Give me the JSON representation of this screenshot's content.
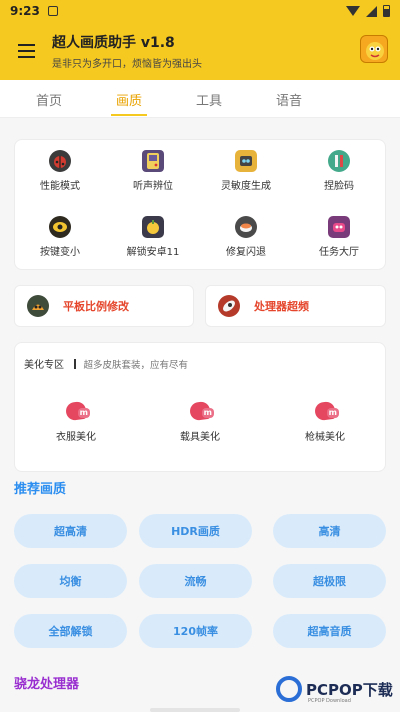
{
  "status": {
    "time": "9:23"
  },
  "app": {
    "title": "超人画质助手 v1.8",
    "subtitle": "是非只为多开口，烦恼皆为强出头"
  },
  "tabs": [
    {
      "label": "首页"
    },
    {
      "label": "画质"
    },
    {
      "label": "工具"
    },
    {
      "label": "语音"
    }
  ],
  "grid": [
    {
      "label": "性能模式",
      "icon": "ladybug-icon",
      "color": "#3b3b3b"
    },
    {
      "label": "听声辨位",
      "icon": "gameboy-icon",
      "color": "#5a4a7a"
    },
    {
      "label": "灵敏度生成",
      "icon": "robot-icon",
      "color": "#e8b33a"
    },
    {
      "label": "捏脸码",
      "icon": "ruler-icon",
      "color": "#43a98a"
    },
    {
      "label": "按键变小",
      "icon": "eye-icon",
      "color": "#2e2a20"
    },
    {
      "label": "解锁安卓11",
      "icon": "lemon-icon",
      "color": "#3a3a4a"
    },
    {
      "label": "修复闪退",
      "icon": "sushi-icon",
      "color": "#4a4a4a"
    },
    {
      "label": "任务大厅",
      "icon": "monster-icon",
      "color": "#7a3b7a"
    }
  ],
  "wide": [
    {
      "label": "平板比例修改",
      "icon": "slime-icon",
      "color": "#3e4a3a"
    },
    {
      "label": "处理器超频",
      "icon": "rocket-icon",
      "color": "#b53a2a"
    }
  ],
  "beauty": {
    "title": "美化专区",
    "desc": "超多皮肤套装，应有尽有",
    "items": [
      {
        "label": "衣服美化"
      },
      {
        "label": "载具美化"
      },
      {
        "label": "枪械美化"
      }
    ]
  },
  "recommend": {
    "title": "推荐画质",
    "title_color": "#2b8ef0",
    "options": [
      {
        "label": "超高清"
      },
      {
        "label": "HDR画质"
      },
      {
        "label": "高清"
      },
      {
        "label": "均衡"
      },
      {
        "label": "流畅"
      },
      {
        "label": "超极限"
      },
      {
        "label": "全部解锁"
      },
      {
        "label": "120帧率"
      },
      {
        "label": "超高音质"
      }
    ]
  },
  "snapdragon": {
    "title": "骁龙处理器",
    "title_color": "#9a2fd0"
  },
  "watermark": {
    "text": "PCPOP",
    "suffix": "下载",
    "sub": "PCPOP Download"
  }
}
